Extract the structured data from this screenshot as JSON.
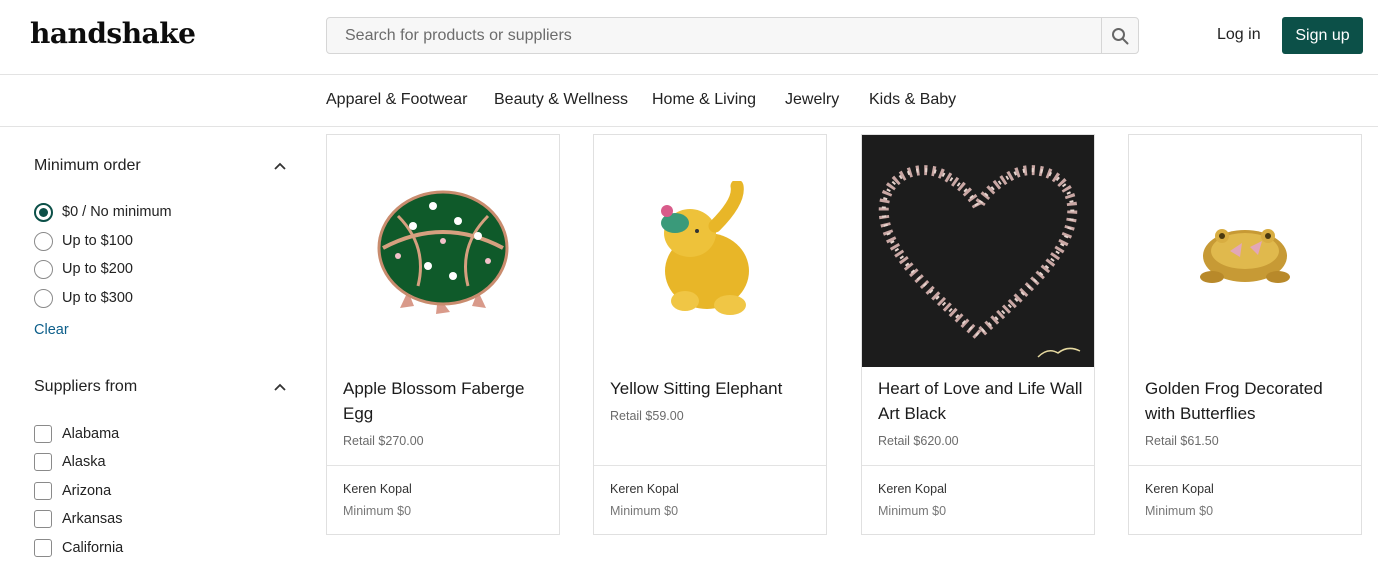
{
  "header": {
    "logo": "handshake",
    "search_placeholder": "Search for products or suppliers",
    "login_label": "Log in",
    "signup_label": "Sign up"
  },
  "nav": {
    "items": [
      "Apparel & Footwear",
      "Beauty & Wellness",
      "Home & Living",
      "Jewelry",
      "Kids & Baby"
    ]
  },
  "filters": {
    "minimum_order": {
      "title": "Minimum order",
      "options": [
        "$0 / No minimum",
        "Up to $100",
        "Up to $200",
        "Up to $300"
      ],
      "selected": "$0 / No minimum",
      "clear_label": "Clear"
    },
    "suppliers_from": {
      "title": "Suppliers from",
      "options": [
        "Alabama",
        "Alaska",
        "Arizona",
        "Arkansas",
        "California"
      ]
    }
  },
  "products": [
    {
      "name": "Apple Blossom Faberge Egg",
      "price": "Retail $270.00",
      "supplier": "Keren Kopal",
      "minimum": "Minimum $0",
      "image_icon": "green-faberge-egg-image"
    },
    {
      "name": "Yellow Sitting Elephant",
      "price": "Retail $59.00",
      "supplier": "Keren Kopal",
      "minimum": "Minimum $0",
      "image_icon": "yellow-elephant-image"
    },
    {
      "name": "Heart of Love and Life Wall Art Black",
      "price": "Retail $620.00",
      "supplier": "Keren Kopal",
      "minimum": "Minimum $0",
      "image_icon": "jeweled-heart-wall-art-image"
    },
    {
      "name": "Golden Frog Decorated with Butterflies",
      "price": "Retail $61.50",
      "supplier": "Keren Kopal",
      "minimum": "Minimum $0",
      "image_icon": "golden-frog-image"
    }
  ],
  "colors": {
    "brand": "#0c5048",
    "link": "#0c5e8a"
  }
}
